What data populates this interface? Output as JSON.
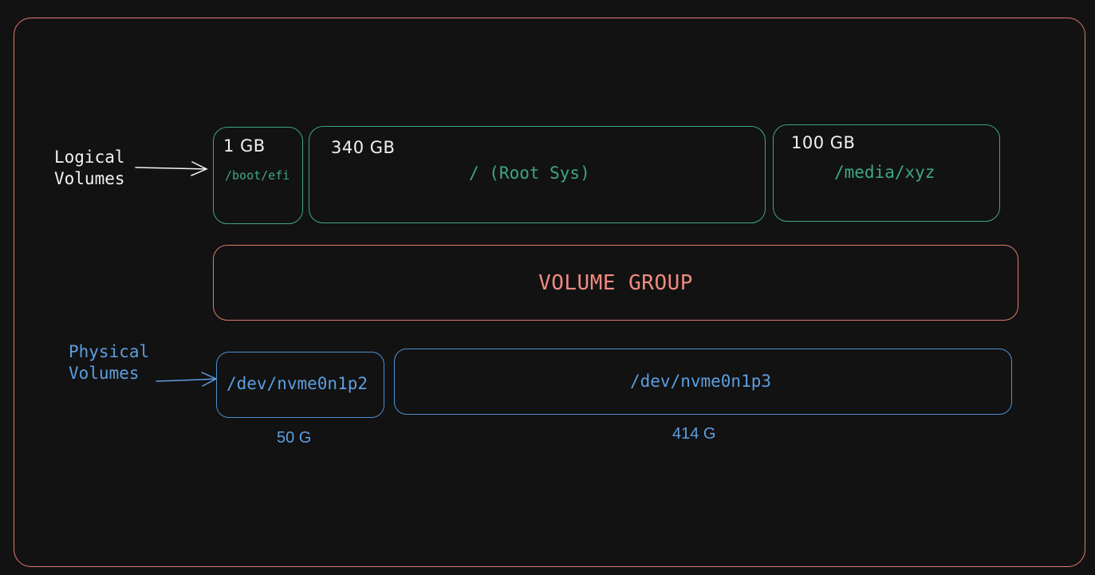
{
  "labels": {
    "logical_volumes": "Logical\nVolumes",
    "physical_volumes": "Physical\nVolumes",
    "volume_group": "VOLUME GROUP"
  },
  "logical_volumes": [
    {
      "size": "1 GB",
      "mount": "/boot/efi"
    },
    {
      "size": "340 GB",
      "mount": "/ (Root Sys)"
    },
    {
      "size": "100 GB",
      "mount": "/media/xyz"
    }
  ],
  "physical_volumes": [
    {
      "device": "/dev/nvme0n1p2",
      "size": "50 G"
    },
    {
      "device": "/dev/nvme0n1p3",
      "size": "414 G"
    }
  ],
  "colors": {
    "background": "#121212",
    "frame": "#e07a6f",
    "logical": "#3fa77f",
    "physical": "#5d9ee0",
    "text": "#f2f2f2"
  }
}
